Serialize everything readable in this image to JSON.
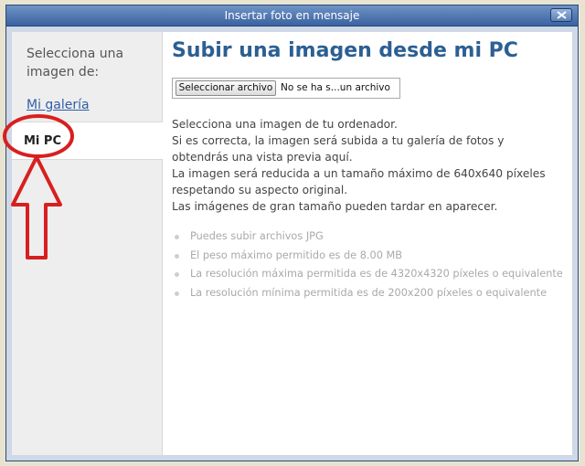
{
  "dialog": {
    "title": "Insertar foto en mensaje"
  },
  "sidebar": {
    "prompt": "Selecciona una imagen de:",
    "gallery_link": "Mi galería",
    "active_tab": "Mi PC"
  },
  "main": {
    "heading": "Subir una imagen desde mi PC",
    "file_button": "Seleccionar archivo",
    "file_status": "No se ha s...un archivo",
    "info_lines": [
      "Selecciona una imagen de tu ordenador.",
      "Si es correcta, la imagen será subida a tu galería de fotos y",
      "obtendrás una vista previa aquí.",
      "La imagen será reducida a un tamaño máximo de 640x640 píxeles",
      "respetando su aspecto original.",
      "Las imágenes de gran tamaño pueden tardar en aparecer."
    ],
    "requirements": [
      "Puedes subir archivos JPG",
      "El peso máximo permitido es de 8.00 MB",
      "La resolución máxima permitida es de 4320x4320 píxeles o equivalente",
      "La resolución mínima permitida es de 200x200 píxeles o equivalente"
    ]
  },
  "colors": {
    "titlebar": "#4a72ae",
    "heading": "#2c5f93",
    "annotation": "#d81f1f"
  },
  "icons": {
    "close": "close-icon",
    "annotation_arrow": "up-arrow-icon"
  }
}
